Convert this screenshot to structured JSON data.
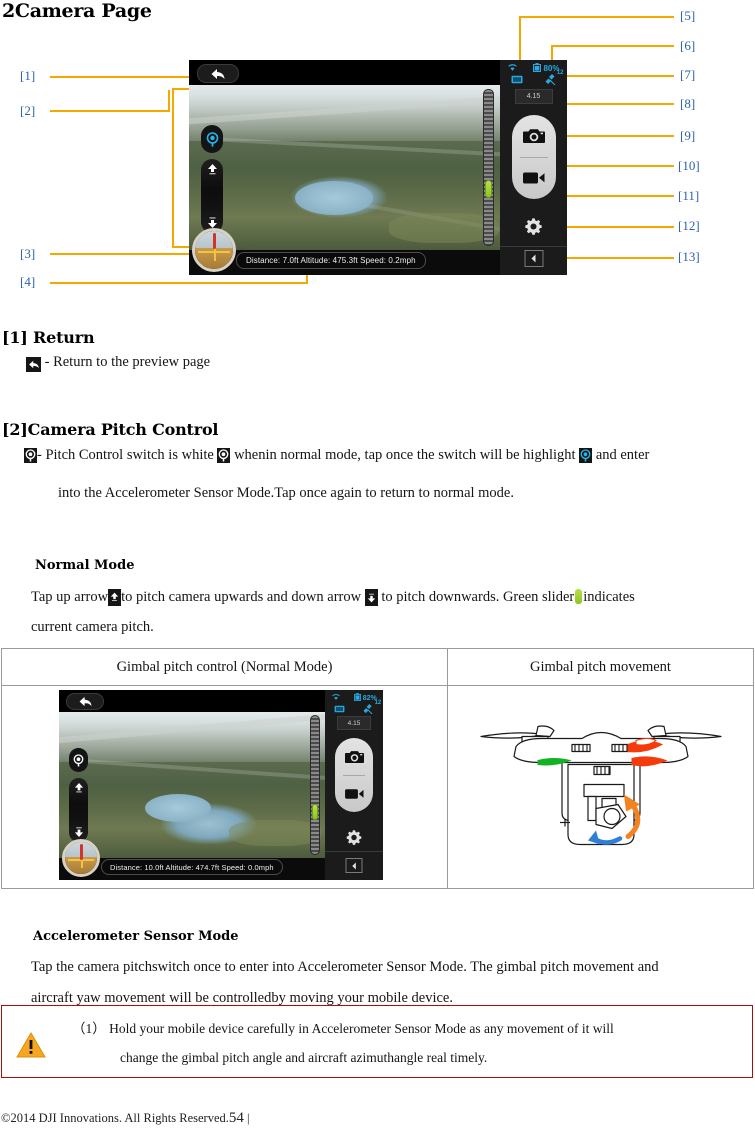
{
  "document": {
    "title": "2Camera Page",
    "footer_copyright": "©2014 DJI Innovations. All Rights Reserved.",
    "footer_page": "54",
    "footer_divider": "|"
  },
  "figure": {
    "callouts": [
      {
        "id": "1",
        "label": "[1]"
      },
      {
        "id": "2",
        "label": "[2]"
      },
      {
        "id": "3",
        "label": "[3]"
      },
      {
        "id": "4",
        "label": "[4]"
      },
      {
        "id": "5",
        "label": "[5]"
      },
      {
        "id": "6",
        "label": "[6]"
      },
      {
        "id": "7",
        "label": "[7]"
      },
      {
        "id": "8",
        "label": "[8]"
      },
      {
        "id": "9",
        "label": "[9]"
      },
      {
        "id": "10",
        "label": "[10]"
      },
      {
        "id": "11",
        "label": "[11]"
      },
      {
        "id": "12",
        "label": "[12]"
      },
      {
        "id": "13",
        "label": "[13]"
      }
    ],
    "leader_color": "#f5a800",
    "label_color": "#2a63b0"
  },
  "app_main": {
    "status": {
      "wifi": "wifi-icon",
      "battery_percent": "80%",
      "downlink": "downlink-icon",
      "satellites": "12"
    },
    "mini_readout": "4.15",
    "telemetry": "Distance:  7.0ft  Altitude: 475.3ft  Speed:  0.2mph",
    "buttons": {
      "back": "back-arrow",
      "pitch_switch": "pitch-control-switch",
      "pitch_up": "arrow-up",
      "pitch_down": "arrow-down",
      "photo": "camera-icon",
      "video": "video-icon",
      "settings": "gear-icon",
      "collapse": "collapse-icon"
    }
  },
  "app_table": {
    "status": {
      "battery_percent": "82%",
      "satellites": "12"
    },
    "mini_readout": "4.15",
    "telemetry": "Distance: 10.0ft  Altitude: 474.7ft  Speed:  0.0mph"
  },
  "sections": {
    "s1": {
      "heading": "[1] Return",
      "body_text": "- Return to the preview page"
    },
    "s2": {
      "heading": "[2]Camera Pitch Control",
      "line1_a": "- Pitch Control switch is white",
      "line1_b": "whenin normal mode, tap once the switch will be highlight",
      "line1_c": "and enter",
      "line2": "into the Accelerometer Sensor Mode.Tap once again to return to normal mode."
    },
    "normal_mode": {
      "heading": "Normal Mode",
      "text_a": "Tap up arrow",
      "text_b": "to pitch camera upwards and down arrow",
      "text_c": "to pitch downwards. Green slider",
      "text_d": "indicates",
      "text_e": "current camera pitch."
    },
    "accel_mode": {
      "heading": "Accelerometer Sensor Mode",
      "line1": "Tap the camera pitchswitch once to enter into Accelerometer Sensor Mode. The gimbal pitch movement and",
      "line2": "aircraft yaw movement will be controlledby moving your mobile device."
    },
    "warning": {
      "number": "（1）",
      "line1": "Hold your mobile device carefully in Accelerometer Sensor Mode as any movement of it will",
      "line2": "change the gimbal pitch angle and aircraft azimuthangle real timely.",
      "border_color": "#a50f0f",
      "icon_color": "#f5a623"
    }
  },
  "table": {
    "headers": [
      "Gimbal pitch control (Normal Mode)",
      "Gimbal pitch movement"
    ]
  },
  "drone": {
    "marker_green": "#12b224",
    "marker_red": "#f53b0c",
    "arrow_orange": "#f58220",
    "arrow_blue": "#2f7fd8"
  }
}
